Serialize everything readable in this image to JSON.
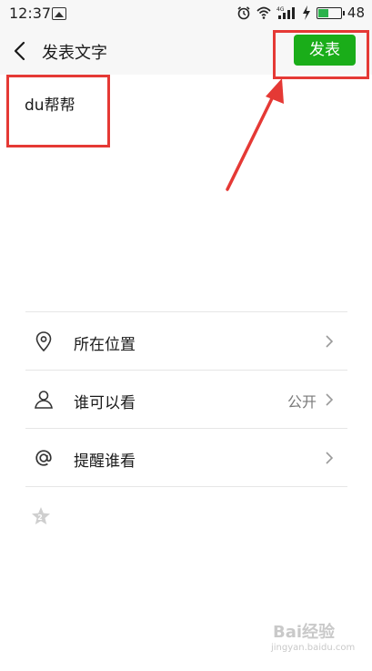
{
  "status_bar": {
    "time": "12:37",
    "battery_text": "48",
    "network_label": "4G"
  },
  "title_bar": {
    "title": "发表文字",
    "publish_label": "发表"
  },
  "editor": {
    "text": "du帮帮"
  },
  "options": [
    {
      "label": "所在位置",
      "value": "",
      "icon": "location-pin-icon"
    },
    {
      "label": "谁可以看",
      "value": "公开",
      "icon": "person-icon"
    },
    {
      "label": "提醒谁看",
      "value": "",
      "icon": "at-icon"
    }
  ],
  "watermark": {
    "brand": "Bai经验",
    "sub": "jingyan.baidu.com"
  },
  "colors": {
    "accent": "#1aad19",
    "annotation": "#e53935"
  },
  "battery_level": 0.48
}
